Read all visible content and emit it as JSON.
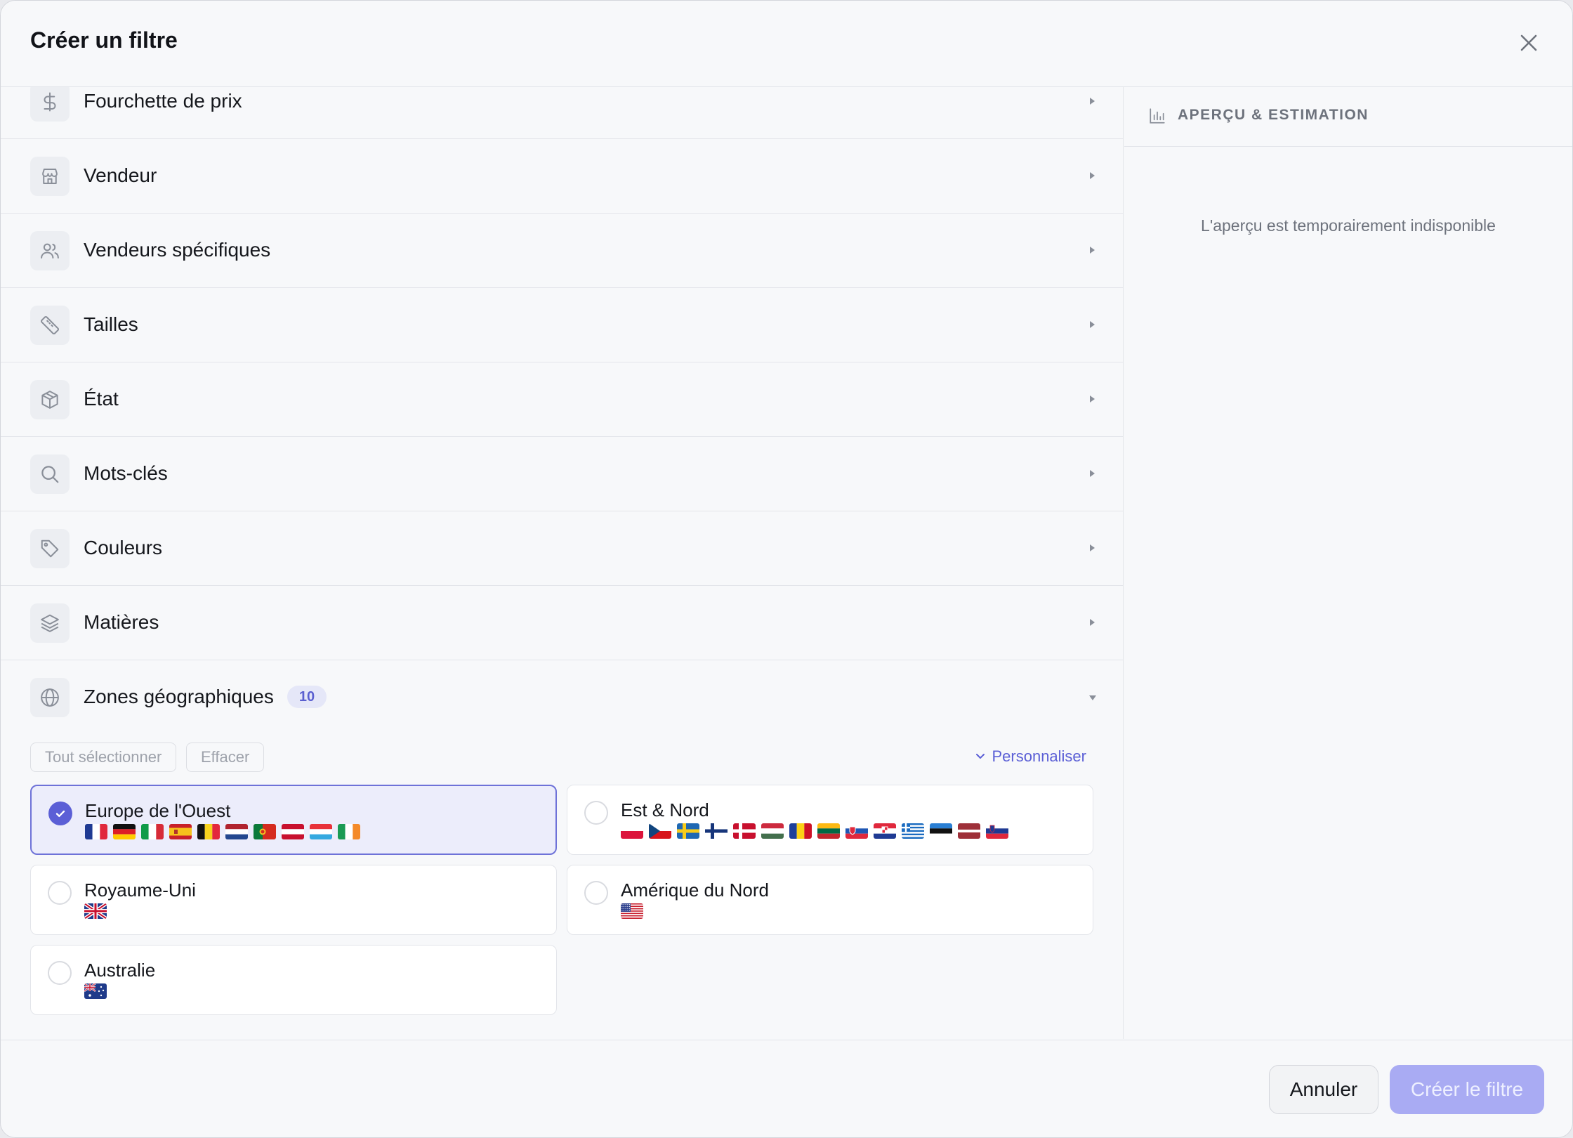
{
  "dialog": {
    "title": "Créer un filtre",
    "close_icon": "close-icon"
  },
  "filters": [
    {
      "label": "Fourchette de prix",
      "icon": "dollar-icon"
    },
    {
      "label": "Vendeur",
      "icon": "store-icon"
    },
    {
      "label": "Vendeurs spécifiques",
      "icon": "users-icon"
    },
    {
      "label": "Tailles",
      "icon": "ruler-icon"
    },
    {
      "label": "État",
      "icon": "box-icon"
    },
    {
      "label": "Mots-clés",
      "icon": "search-icon"
    },
    {
      "label": "Couleurs",
      "icon": "tag-icon"
    },
    {
      "label": "Matières",
      "icon": "layers-icon"
    }
  ],
  "zones": {
    "label": "Zones géographiques",
    "icon": "globe-icon",
    "count": "10",
    "select_all": "Tout sélectionner",
    "clear": "Effacer",
    "customize": "Personnaliser",
    "regions": [
      {
        "label": "Europe de l'Ouest",
        "selected": true,
        "flags": [
          "fr",
          "de",
          "it",
          "es",
          "be",
          "nl",
          "pt",
          "at",
          "lu",
          "ie"
        ]
      },
      {
        "label": "Est & Nord",
        "selected": false,
        "flags": [
          "pl",
          "cz",
          "se",
          "fi",
          "dk",
          "hu",
          "ro",
          "lt",
          "sk",
          "hr",
          "gr",
          "ee",
          "lv",
          "si"
        ]
      },
      {
        "label": "Royaume-Uni",
        "selected": false,
        "flags": [
          "gb"
        ]
      },
      {
        "label": "Amérique du Nord",
        "selected": false,
        "flags": [
          "us"
        ]
      },
      {
        "label": "Australie",
        "selected": false,
        "flags": [
          "au"
        ]
      }
    ]
  },
  "preview": {
    "title": "APERÇU & ESTIMATION",
    "icon": "bar-chart-icon",
    "message": "L'aperçu est temporairement indisponible"
  },
  "footer": {
    "cancel_label": "Annuler",
    "create_label": "Créer le filtre"
  },
  "colors": {
    "accent": "#5b5fd6",
    "accent_light": "#a9abf3",
    "selected_bg": "#ecedfb"
  }
}
